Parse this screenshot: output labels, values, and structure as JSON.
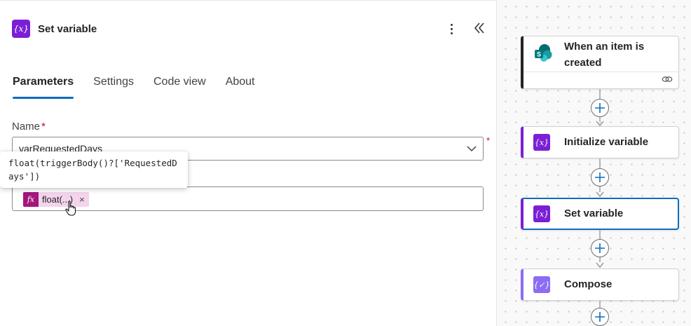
{
  "panel": {
    "title": "Set variable",
    "icon": "variable-icon",
    "accent_color": "#7b1fd6"
  },
  "tabs": [
    {
      "label": "Parameters",
      "active": true
    },
    {
      "label": "Settings",
      "active": false
    },
    {
      "label": "Code view",
      "active": false
    },
    {
      "label": "About",
      "active": false
    }
  ],
  "form": {
    "name_label": "Name",
    "required_mark": "*",
    "name_value": "varRequestedDays",
    "value_token_label": "float(...)",
    "value_token_icon": "function-icon",
    "token_close": "×"
  },
  "tooltip": {
    "expression": "float(triggerBody()?['RequestedDays'])"
  },
  "flow": {
    "trigger_label": "When an item is created",
    "trigger_icon": "sharepoint-icon",
    "init_label": "Initialize variable",
    "set_label": "Set variable",
    "compose_label": "Compose",
    "selected_color": "#0f6cbd"
  }
}
